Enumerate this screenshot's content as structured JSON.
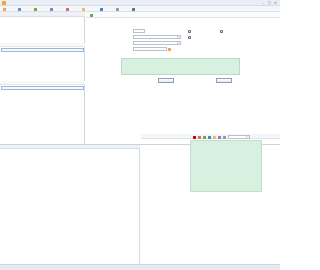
{
  "window": {
    "title": "",
    "min": "–",
    "max": "□",
    "close": "×"
  },
  "menu": [
    {
      "label": "",
      "icon": "home-icon",
      "color": "#f2a33a"
    },
    {
      "label": "",
      "icon": "grid-icon",
      "color": "#5b8fd6"
    },
    {
      "label": "",
      "icon": "list-icon",
      "color": "#6aa84f"
    },
    {
      "label": "",
      "icon": "doc-icon",
      "color": "#8e7cc3"
    },
    {
      "label": "",
      "icon": "chart-icon",
      "color": "#e06666"
    },
    {
      "label": "",
      "icon": "folder-icon",
      "color": "#f6b26b"
    },
    {
      "label": "",
      "icon": "user-icon",
      "color": "#3d85c6"
    },
    {
      "label": "",
      "icon": "gear-icon",
      "color": "#999999"
    },
    {
      "label": "",
      "icon": "help-icon",
      "color": "#45818e"
    }
  ],
  "left": {
    "header": "",
    "panel1": {
      "col_a": "",
      "col_b": "",
      "selected": ""
    },
    "panel2": {
      "col_a": "",
      "selected": ""
    },
    "totals": [
      {
        "label": "",
        "value": ""
      },
      {
        "label": "",
        "value": ""
      }
    ]
  },
  "form": {
    "toolbar_label": "",
    "rows": [
      {
        "label": "",
        "value": ""
      },
      {
        "label": "",
        "value": ""
      },
      {
        "label": "",
        "value": ""
      },
      {
        "label": "",
        "value": ""
      }
    ],
    "radio_a": "",
    "radio_b": "",
    "radio_c": "",
    "memo_label": "",
    "btn_left": "",
    "btn_right": ""
  },
  "bottom": {
    "left_header": "",
    "right_header": "",
    "amounts": [
      {
        "label": "",
        "value": ""
      },
      {
        "label": "",
        "value": ""
      },
      {
        "label": "",
        "value": ""
      },
      {
        "label": "",
        "value": ""
      },
      {
        "label": "",
        "value": ""
      },
      {
        "label": "",
        "value": ""
      }
    ],
    "footer_amounts": [
      {
        "label": "",
        "value": ""
      },
      {
        "label": "",
        "value": ""
      },
      {
        "label": "",
        "value": ""
      }
    ]
  },
  "status": {
    "text": ""
  }
}
